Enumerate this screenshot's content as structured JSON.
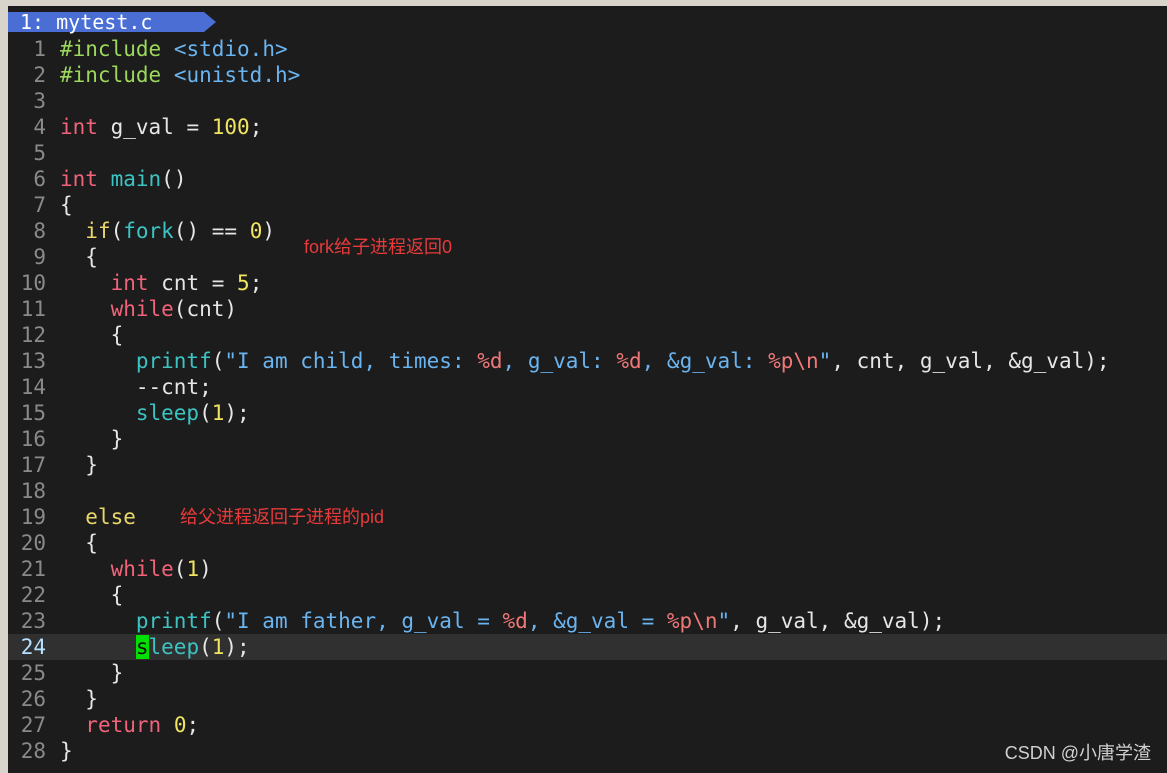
{
  "tab": {
    "label": "1: mytest.c"
  },
  "annotations": {
    "fork_child": "fork给子进程返回0",
    "fork_parent": "给父进程返回子进程的pid"
  },
  "watermark": "CSDN @小唐学渣",
  "cursor_line": 24,
  "lines": [
    {
      "n": "1",
      "t": "#include <stdio.h>"
    },
    {
      "n": "2",
      "t": "#include <unistd.h>"
    },
    {
      "n": "3",
      "t": ""
    },
    {
      "n": "4",
      "t": "int g_val = 100;"
    },
    {
      "n": "5",
      "t": ""
    },
    {
      "n": "6",
      "t": "int main()"
    },
    {
      "n": "7",
      "t": "{"
    },
    {
      "n": "8",
      "t": "  if(fork() == 0)"
    },
    {
      "n": "9",
      "t": "  {"
    },
    {
      "n": "10",
      "t": "    int cnt = 5;"
    },
    {
      "n": "11",
      "t": "    while(cnt)"
    },
    {
      "n": "12",
      "t": "    {"
    },
    {
      "n": "13",
      "t": "      printf(\"I am child, times: %d, g_val: %d, &g_val: %p\\n\", cnt, g_val, &g_val);"
    },
    {
      "n": "14",
      "t": "      --cnt;"
    },
    {
      "n": "15",
      "t": "      sleep(1);"
    },
    {
      "n": "16",
      "t": "    }"
    },
    {
      "n": "17",
      "t": "  }"
    },
    {
      "n": "18",
      "t": ""
    },
    {
      "n": "19",
      "t": "  else"
    },
    {
      "n": "20",
      "t": "  {"
    },
    {
      "n": "21",
      "t": "    while(1)"
    },
    {
      "n": "22",
      "t": "    {"
    },
    {
      "n": "23",
      "t": "      printf(\"I am father, g_val = %d, &g_val = %p\\n\", g_val, &g_val);"
    },
    {
      "n": "24",
      "t": "      sleep(1);"
    },
    {
      "n": "25",
      "t": "    }"
    },
    {
      "n": "26",
      "t": "  }"
    },
    {
      "n": "27",
      "t": "  return 0;"
    },
    {
      "n": "28",
      "t": "}"
    }
  ],
  "colors": {
    "background": "#1c1c1c",
    "tab_active": "#4a6ed4",
    "annotation": "#e83a3a",
    "cursor": "#00e000"
  }
}
